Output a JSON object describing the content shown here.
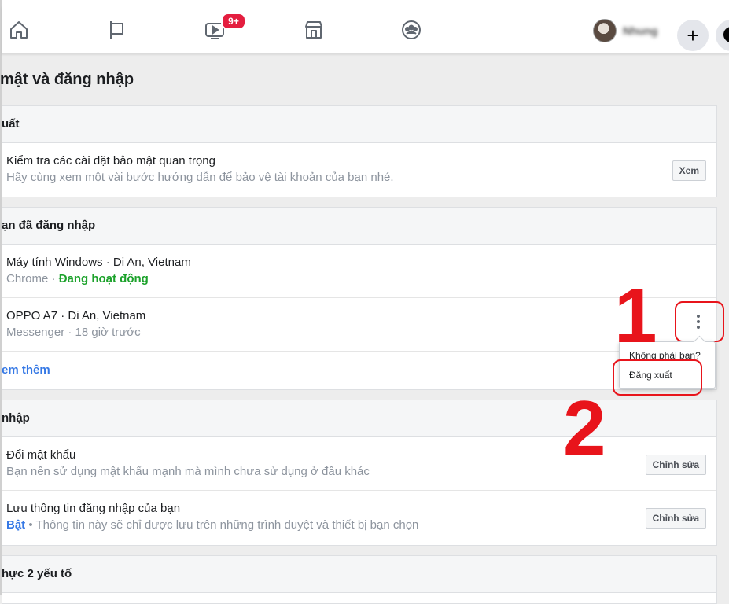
{
  "nav": {
    "video_badge": "9+",
    "profile_name": "Nhung",
    "plus_symbol": "+",
    "icons": [
      "home-icon",
      "pages-flag-icon",
      "watch-video-icon",
      "marketplace-icon",
      "groups-icon"
    ]
  },
  "page": {
    "title": "mật và đăng nhập"
  },
  "security_checkup": {
    "header": "uất",
    "row_title": "Kiểm tra các cài đặt bảo mật quan trọng",
    "row_sub": "Hãy cùng xem một vài bước hướng dẫn để bảo vệ tài khoản của bạn nhé.",
    "button": "Xem"
  },
  "where_logged_in": {
    "header": "ạn đã đăng nhập",
    "sessions": [
      {
        "device": "Máy tính Windows · Di An, Vietnam",
        "app": "Chrome · ",
        "status": "Đang hoạt động"
      },
      {
        "device": "OPPO A7 · Di An, Vietnam",
        "app": "Messenger · 18 giờ trước",
        "status": ""
      }
    ],
    "see_more": "em thêm"
  },
  "session_menu": {
    "items": [
      "Không phải bạn?",
      "Đăng xuất"
    ]
  },
  "login": {
    "header": " nhập",
    "rows": [
      {
        "title": "Đổi mật khẩu",
        "sub": "Bạn nên sử dụng mật khẩu mạnh mà mình chưa sử dụng ở đâu khác",
        "button": "Chỉnh sửa"
      },
      {
        "title": "Lưu thông tin đăng nhập của bạn",
        "sub_prefix": "Bật",
        "sub": " • Thông tin này sẽ chỉ được lưu trên những trình duyệt và thiết bị bạn chọn",
        "button": "Chỉnh sửa"
      }
    ]
  },
  "two_factor": {
    "header": "hực 2 yếu tố"
  },
  "annotations": {
    "step1": "1",
    "step2": "2",
    "color": "#e8141b"
  }
}
